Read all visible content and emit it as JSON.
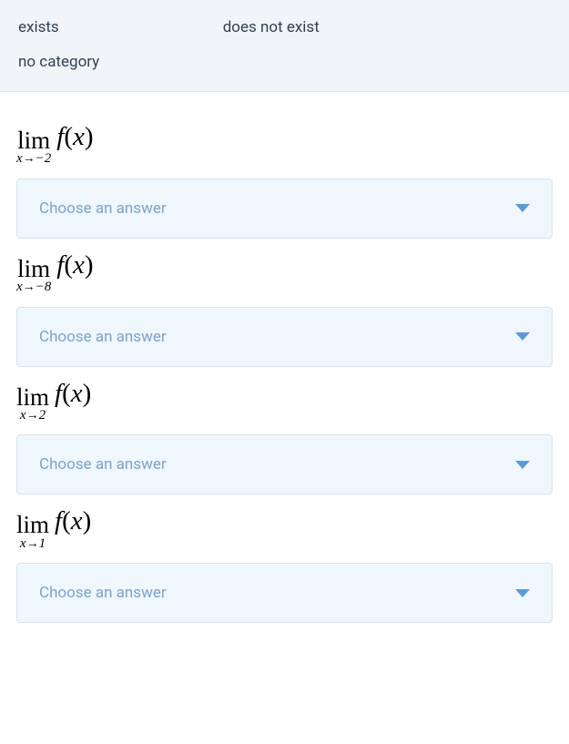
{
  "categories": {
    "exists": "exists",
    "does_not_exist": "does not exist",
    "no_category": "no category"
  },
  "questions": [
    {
      "lim_text": "lim",
      "approach_var": "x",
      "approach_arrow": "→",
      "approach_value": "−2",
      "func_f": "f",
      "func_open": "(",
      "func_var": "x",
      "func_close": ")",
      "dropdown_label": "Choose an answer"
    },
    {
      "lim_text": "lim",
      "approach_var": "x",
      "approach_arrow": "→",
      "approach_value": "−8",
      "func_f": "f",
      "func_open": "(",
      "func_var": "x",
      "func_close": ")",
      "dropdown_label": "Choose an answer"
    },
    {
      "lim_text": "lim",
      "approach_var": "x",
      "approach_arrow": "→",
      "approach_value": "2",
      "func_f": "f",
      "func_open": "(",
      "func_var": "x",
      "func_close": ")",
      "dropdown_label": "Choose an answer"
    },
    {
      "lim_text": "lim",
      "approach_var": "x",
      "approach_arrow": "→",
      "approach_value": "1",
      "func_f": "f",
      "func_open": "(",
      "func_var": "x",
      "func_close": ")",
      "dropdown_label": "Choose an answer"
    }
  ]
}
